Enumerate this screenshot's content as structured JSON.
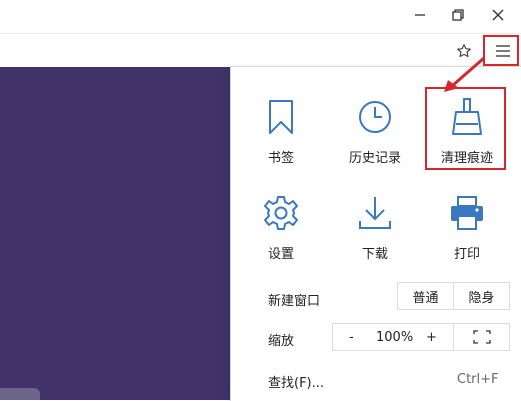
{
  "window_controls": {
    "minimize": "minimize-icon",
    "restore": "restore-icon",
    "close": "close-icon"
  },
  "toolbar": {
    "favorite": "star-icon",
    "menu": "hamburger-menu-icon"
  },
  "menu": {
    "grid": [
      {
        "label": "书签",
        "icon": "bookmark-icon"
      },
      {
        "label": "历史记录",
        "icon": "clock-icon"
      },
      {
        "label": "清理痕迹",
        "icon": "broom-icon"
      },
      {
        "label": "设置",
        "icon": "gear-icon"
      },
      {
        "label": "下载",
        "icon": "download-icon"
      },
      {
        "label": "打印",
        "icon": "printer-icon"
      }
    ],
    "new_window": {
      "label": "新建窗口",
      "normal": "普通",
      "incognito": "隐身"
    },
    "zoom": {
      "label": "缩放",
      "minus": "-",
      "value": "100%",
      "plus": "+",
      "fullscreen": "fullscreen-icon"
    },
    "find": {
      "label": "查找(F)...",
      "shortcut": "Ctrl+F"
    }
  },
  "colors": {
    "accent_icon": "#3b78c2",
    "highlight": "#d7262e",
    "content_bg": "#413369"
  }
}
